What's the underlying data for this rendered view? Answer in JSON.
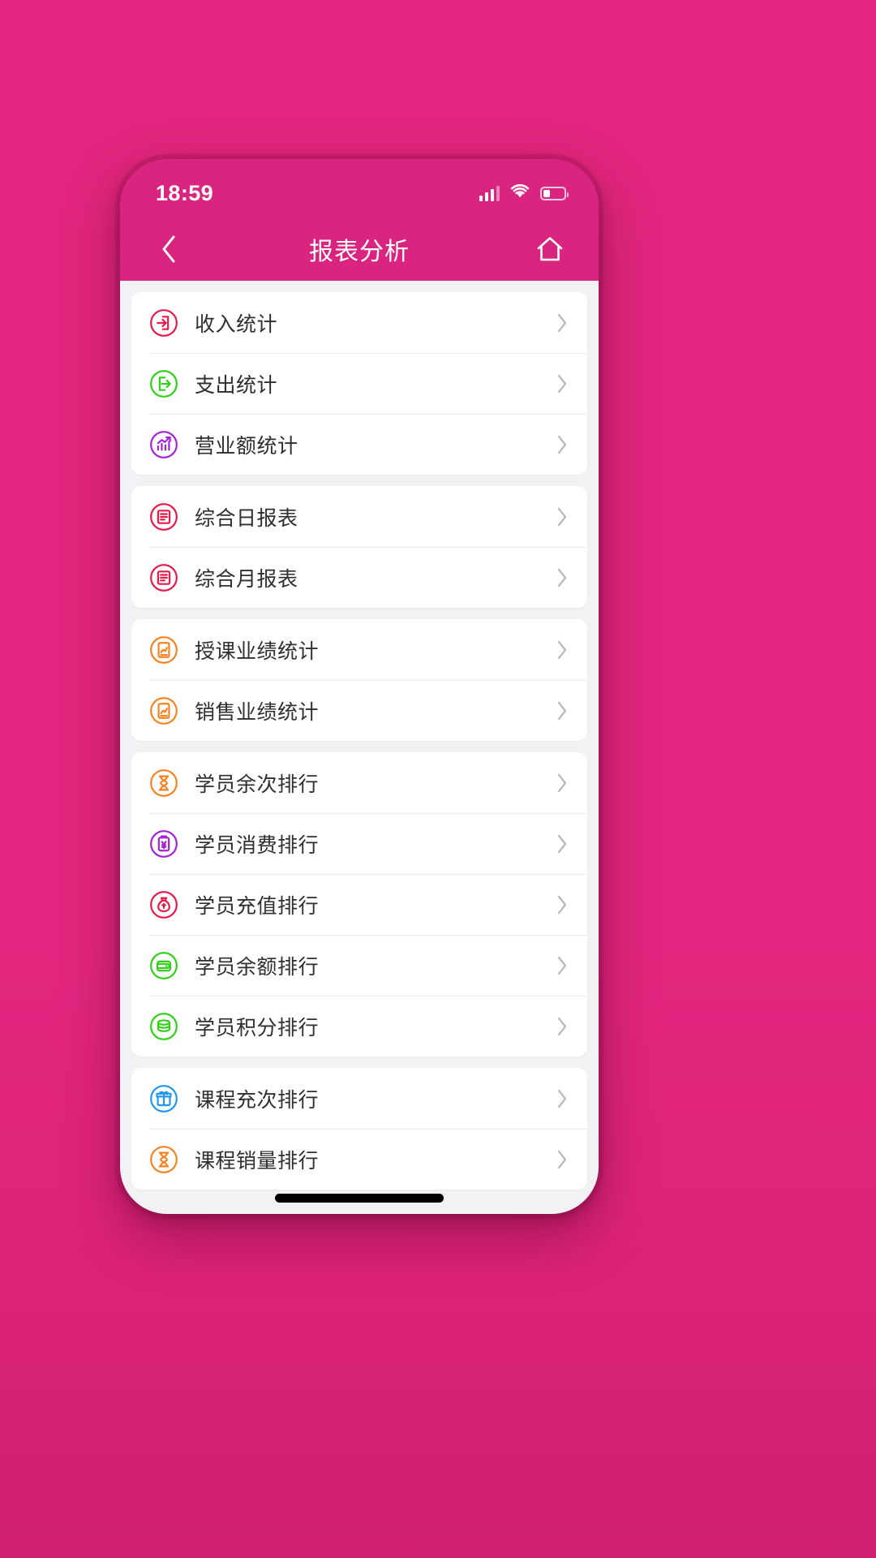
{
  "theme": {
    "brand_pink": "#e2267f",
    "phone_pink": "#d9257f",
    "content_bg": "#f2f2f4",
    "card_white": "#ffffff",
    "label_color": "#2e2e33"
  },
  "status_bar": {
    "time": "18:59",
    "signal_icon": "signal-bars-icon",
    "wifi_icon": "wifi-icon",
    "battery_icon": "battery-icon",
    "battery_percent": 35
  },
  "nav_bar": {
    "back_icon": "chevron-left-icon",
    "title": "报表分析",
    "home_icon": "home-icon"
  },
  "groups": [
    {
      "name": "statistics-group",
      "rows": [
        {
          "label": "收入统计",
          "icon": "income-arrow-in-icon",
          "color": "#e8194b",
          "glyph": "login",
          "chevron": "chevron-right-icon"
        },
        {
          "label": "支出统计",
          "icon": "expense-arrow-out-icon",
          "color": "#2fd016",
          "glyph": "logout",
          "chevron": "chevron-right-icon"
        },
        {
          "label": "营业额统计",
          "icon": "revenue-chart-icon",
          "color": "#a520d8",
          "glyph": "chartup",
          "chevron": "chevron-right-icon"
        }
      ]
    },
    {
      "name": "comprehensive-reports-group",
      "rows": [
        {
          "label": "综合日报表",
          "icon": "daily-report-icon",
          "color": "#e8194b",
          "glyph": "report",
          "chevron": "chevron-right-icon"
        },
        {
          "label": "综合月报表",
          "icon": "monthly-report-icon",
          "color": "#e8194b",
          "glyph": "report",
          "chevron": "chevron-right-icon"
        }
      ]
    },
    {
      "name": "performance-group",
      "rows": [
        {
          "label": "授课业绩统计",
          "icon": "teaching-performance-icon",
          "color": "#f58220",
          "glyph": "doc-chart",
          "chevron": "chevron-right-icon"
        },
        {
          "label": "销售业绩统计",
          "icon": "sales-performance-icon",
          "color": "#f58220",
          "glyph": "doc-chart",
          "chevron": "chevron-right-icon"
        }
      ]
    },
    {
      "name": "student-ranking-group",
      "rows": [
        {
          "label": "学员余次排行",
          "icon": "remaining-sessions-icon",
          "color": "#f58220",
          "glyph": "hourglass",
          "chevron": "chevron-right-icon"
        },
        {
          "label": "学员消费排行",
          "icon": "consumption-rank-icon",
          "color": "#a520d8",
          "glyph": "clipboard",
          "chevron": "chevron-right-icon"
        },
        {
          "label": "学员充值排行",
          "icon": "recharge-rank-icon",
          "color": "#e8194b",
          "glyph": "moneybag",
          "chevron": "chevron-right-icon"
        },
        {
          "label": "学员余额排行",
          "icon": "balance-rank-icon",
          "color": "#2fd016",
          "glyph": "wallet",
          "chevron": "chevron-right-icon"
        },
        {
          "label": "学员积分排行",
          "icon": "points-rank-icon",
          "color": "#2fd016",
          "glyph": "coins",
          "chevron": "chevron-right-icon"
        }
      ]
    },
    {
      "name": "course-ranking-group",
      "rows": [
        {
          "label": "课程充次排行",
          "icon": "course-recharge-icon",
          "color": "#2196f3",
          "glyph": "gift",
          "chevron": "chevron-right-icon"
        },
        {
          "label": "课程销量排行",
          "icon": "course-sales-icon",
          "color": "#f58220",
          "glyph": "hourglass",
          "chevron": "chevron-right-icon"
        }
      ]
    }
  ],
  "home_indicator": "home-indicator-bar"
}
